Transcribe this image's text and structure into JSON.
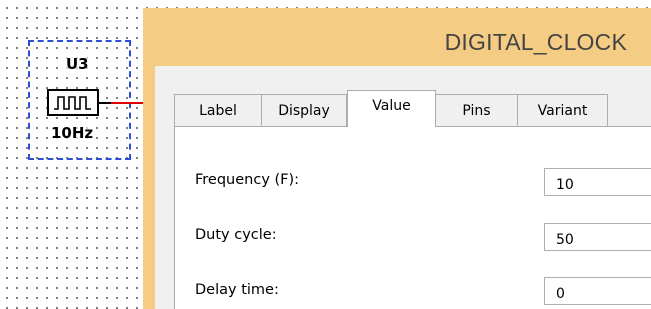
{
  "schematic": {
    "component": {
      "reference": "U3",
      "value": "10Hz",
      "symbol_icon": "clock-pulse-icon"
    }
  },
  "dialog": {
    "title": "DIGITAL_CLOCK",
    "tabs": [
      {
        "label": "Label",
        "active": false
      },
      {
        "label": "Display",
        "active": false
      },
      {
        "label": "Value",
        "active": true
      },
      {
        "label": "Pins",
        "active": false
      },
      {
        "label": "Variant",
        "active": false
      }
    ],
    "fields": [
      {
        "label": "Frequency (F):",
        "value": "10"
      },
      {
        "label": "Duty cycle:",
        "value": "50"
      },
      {
        "label": "Delay time:",
        "value": "0"
      }
    ]
  },
  "colors": {
    "selection_border": "#2b4fd8",
    "wire": "#e00000",
    "title_bar": "#f5cc84",
    "dialog_background": "#f0f0f0"
  }
}
